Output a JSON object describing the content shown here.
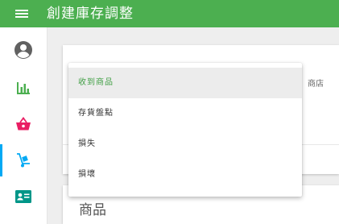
{
  "header": {
    "title": "創建庫存調整",
    "menu_icon": "hamburger-menu-icon",
    "color": "#4caf50"
  },
  "sidebar": {
    "items": [
      {
        "icon": "account-circle-icon",
        "color": "#616161",
        "active": false
      },
      {
        "icon": "bar-chart-icon",
        "color": "#4caf50",
        "active": false
      },
      {
        "icon": "shopping-basket-icon",
        "color": "#e91e63",
        "active": false
      },
      {
        "icon": "hand-truck-icon",
        "color": "#03a9f4",
        "active": true
      },
      {
        "icon": "contact-card-icon",
        "color": "#009688",
        "active": false
      }
    ]
  },
  "form": {
    "store_label": "商店"
  },
  "dropdown": {
    "selected_index": 0,
    "options": [
      "收到商品",
      "存貨盤點",
      "損失",
      "損壞"
    ]
  },
  "products": {
    "title": "商品"
  }
}
